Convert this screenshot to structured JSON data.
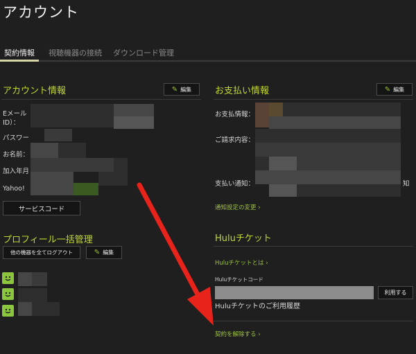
{
  "header": {
    "title": "アカウント"
  },
  "tabs": [
    {
      "label": "契約情報",
      "active": true
    },
    {
      "label": "視聴機器の接続",
      "active": false
    },
    {
      "label": "ダウンロード管理",
      "active": false
    }
  ],
  "account_info": {
    "title": "アカウント情報",
    "edit_label": "編集",
    "fields": {
      "email_line1": "Eメール",
      "email_line2": "ID）：",
      "password": "パスワー",
      "name": "お名前：",
      "joined": "加入年月",
      "yahoo": "Yahoo!"
    },
    "service_code_label": "サービスコード"
  },
  "payment_info": {
    "title": "お支払い情報",
    "edit_label": "編集",
    "fields": {
      "method": "お支払情報：",
      "billing": "ご請求内容：",
      "notice": "支払い通知：",
      "notice_tail": "知"
    },
    "notice_settings_link": "通知設定の変更 ›"
  },
  "profile": {
    "title": "プロフィール一括管理",
    "logout_all_label": "他の機器を全てログアウト",
    "edit_label": "編集"
  },
  "hulu_ticket": {
    "title": "Huluチケット",
    "about_link": "Huluチケットとは ›",
    "code_label": "Huluチケットコード",
    "use_label": "利用する",
    "history_label": "Huluチケットのご利用履歴"
  },
  "cancel_link": "契約を解除する ›",
  "colors": {
    "accent": "#c4d830",
    "link": "#9cc53a",
    "arrow": "#e8231c",
    "background": "#1f1f1f"
  }
}
